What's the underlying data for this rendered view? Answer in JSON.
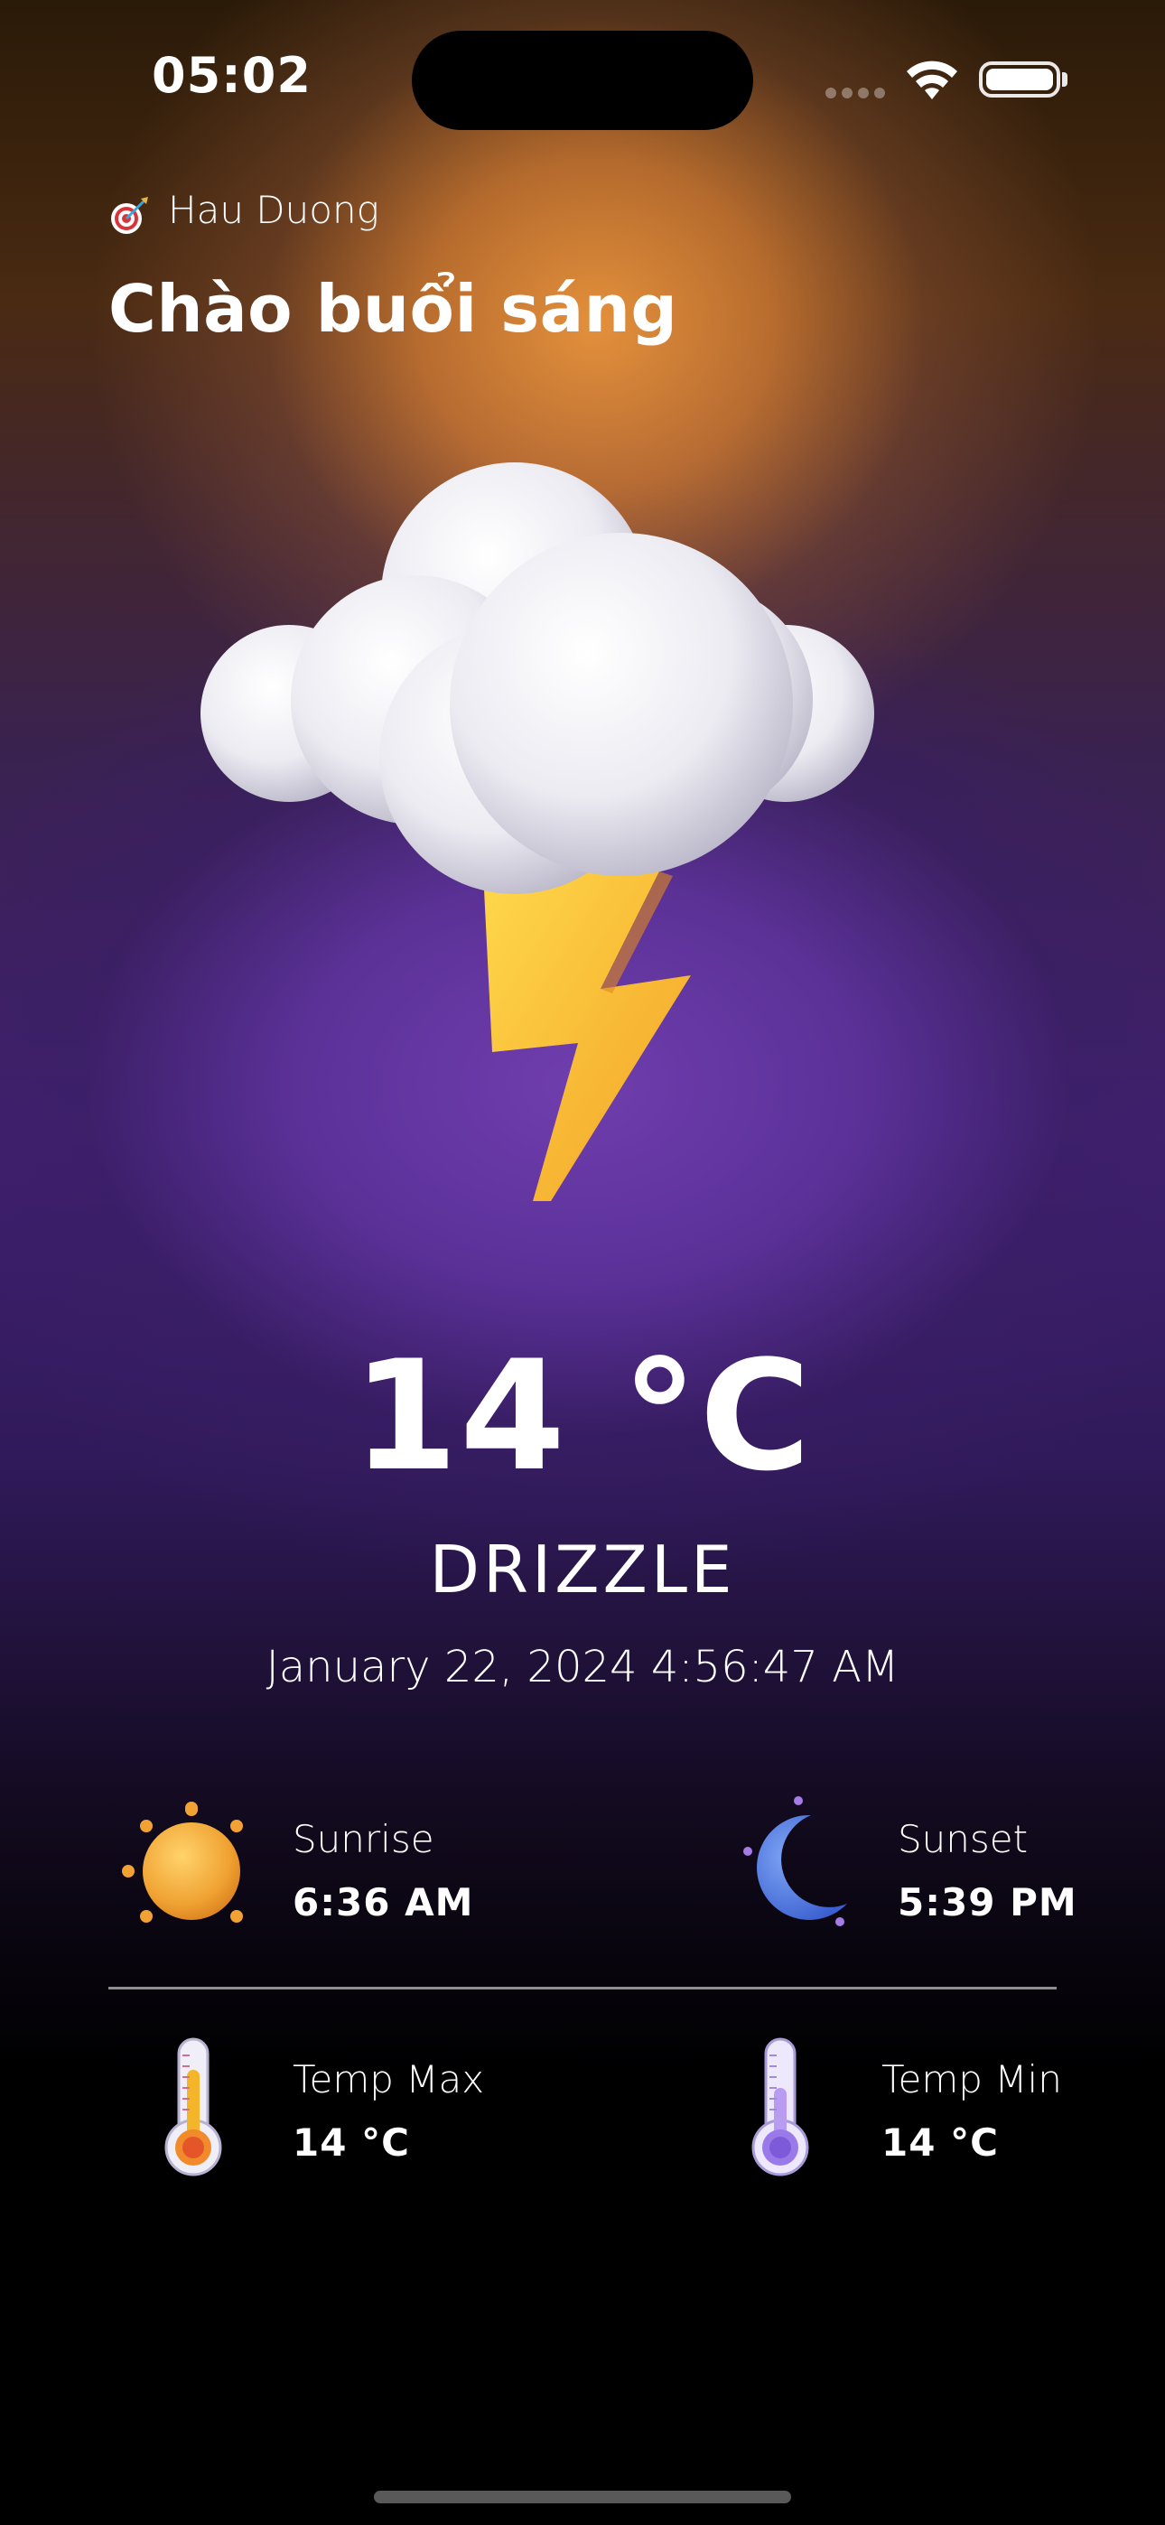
{
  "status_bar": {
    "time": "05:02"
  },
  "header": {
    "location": "Hau Duong",
    "greeting": "Chào buổi sáng"
  },
  "current": {
    "temperature": "14 °C",
    "condition": "DRIZZLE",
    "datetime": "January 22, 2024 4:56:47 AM",
    "icon": "thunderstorm-cloud-icon"
  },
  "sun": {
    "sunrise_label": "Sunrise",
    "sunrise_value": "6:36 AM",
    "sunset_label": "Sunset",
    "sunset_value": "5:39 PM"
  },
  "temps": {
    "max_label": "Temp Max",
    "max_value": "14 °C",
    "min_label": "Temp Min",
    "min_value": "14 °C"
  },
  "colors": {
    "accent_orange": "#E8963E",
    "accent_purple": "#6E3EAE",
    "bolt_yellow": "#F5B82E"
  }
}
